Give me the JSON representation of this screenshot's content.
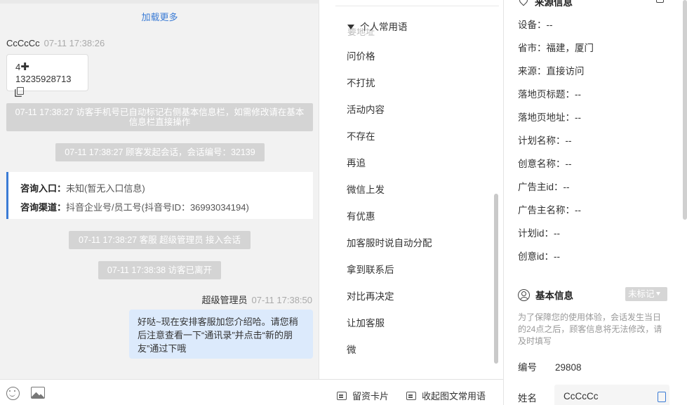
{
  "chat": {
    "load_more": "加载更多",
    "visitor_name": "CcCcCc",
    "visitor_time": "07-11 17:38:26",
    "card_top": "4",
    "card_phone": "13235928713",
    "sys1": "07-11 17:38:27 访客手机号已自动标记右侧基本信息栏，如需修改请在基本信息栏直接操作",
    "sys2": "07-11 17:38:27 顾客发起会话，会话编号：32139",
    "consult_entry_label": "咨询入口：",
    "consult_entry_value": "未知(暂无入口信息)",
    "consult_channel_label": "咨询渠道：",
    "consult_channel_value": "抖音企业号/员工号(抖音号ID：36993034194)",
    "sys3": "07-11 17:38:27 客服 超级管理员 接入会话",
    "sys4": "07-11 17:38:38 访客已离开",
    "agent_name": "超级管理员",
    "agent_time": "07-11 17:38:50",
    "agent_message": "好哒~现在安排客服加您介绍哈。请您稍后注意查看一下“通讯录”并点击“新的朋友”通过下哦",
    "icons": [
      "emoji-icon",
      "image-icon"
    ]
  },
  "phrases": {
    "group_title": "个人常用语",
    "ghost_text": "要地址",
    "items": [
      "问价格",
      "不打扰",
      "活动内容",
      "不存在",
      "再追",
      "微信上发",
      "有优惠",
      "加客服时说自动分配",
      "拿到联系后",
      "对比再决定",
      "让加客服",
      "微"
    ],
    "bottom_card": "留资卡片",
    "bottom_collapse": "收起图文常用语"
  },
  "info": {
    "source_title": "来源信息",
    "source_items": [
      "设备：--",
      "省市：福建，厦门",
      "来源：直接访问",
      "落地页标题：--",
      "落地页地址：--",
      "计划名称：--",
      "创意名称：--",
      "广告主id：--",
      "广告主名称：--",
      "计划id：--",
      "创意id：--"
    ],
    "basic_title": "基本信息",
    "tag_value": "未标记",
    "note": "为了保障您的使用体验，会话发生当日的24点之后，顾客信息将无法修改，请及时填写",
    "id_label": "编号",
    "id_value": "29808",
    "name_label": "姓名",
    "name_value": "CcCcCc"
  }
}
